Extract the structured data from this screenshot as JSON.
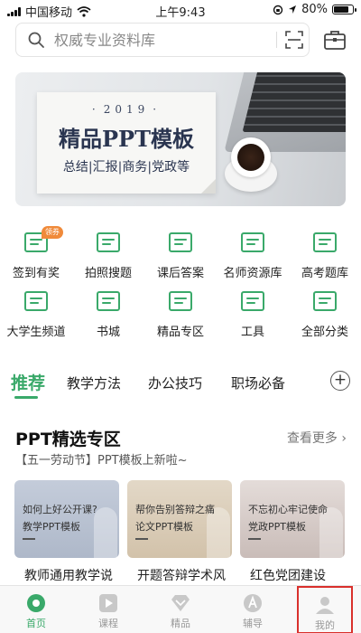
{
  "status_bar": {
    "carrier": "中国移动",
    "time": "上午9:43",
    "battery": "80%",
    "battery_level": 0.8
  },
  "search": {
    "placeholder": "权威专业资料库",
    "icon": "search-icon",
    "scan_icon": "scan-icon",
    "bag_icon": "briefcase-icon"
  },
  "banner": {
    "year": "2019",
    "title": "精品PPT模板",
    "subtitle": "总结|汇报|商务|党政等"
  },
  "shortcuts": [
    {
      "label": "签到有奖",
      "badge": "领券"
    },
    {
      "label": "拍照搜题"
    },
    {
      "label": "课后答案"
    },
    {
      "label": "名师资源库"
    },
    {
      "label": "高考题库"
    },
    {
      "label": "大学生频道"
    },
    {
      "label": "书城"
    },
    {
      "label": "精品专区"
    },
    {
      "label": "工具"
    },
    {
      "label": "全部分类"
    }
  ],
  "tabs": [
    {
      "label": "推荐",
      "active": true
    },
    {
      "label": "教学方法"
    },
    {
      "label": "办公技巧"
    },
    {
      "label": "职场必备"
    }
  ],
  "section": {
    "title": "PPT精选专区",
    "more": "查看更多 ›",
    "subtitle": "【五一劳动节】PPT模板上新啦~"
  },
  "cards": [
    {
      "line1": "如何上好公开课?",
      "line2": "教学PPT模板",
      "caption": "教师通用教学说"
    },
    {
      "line1": "帮你告别答辩之痛",
      "line2": "论文PPT模板",
      "caption": "开题答辩学术风"
    },
    {
      "line1": "不忘初心牢记使命",
      "line2": "党政PPT模板",
      "caption": "红色党团建设"
    }
  ],
  "bottom_nav": [
    {
      "label": "首页",
      "icon": "home-icon",
      "active": true
    },
    {
      "label": "课程",
      "icon": "play-icon"
    },
    {
      "label": "精品",
      "icon": "diamond-icon"
    },
    {
      "label": "辅导",
      "icon": "tutor-icon"
    },
    {
      "label": "我的",
      "icon": "profile-icon",
      "highlighted": true
    }
  ],
  "colors": {
    "accent": "#3aa96a",
    "badge": "#f08a3a",
    "highlight_border": "#d9302c"
  }
}
